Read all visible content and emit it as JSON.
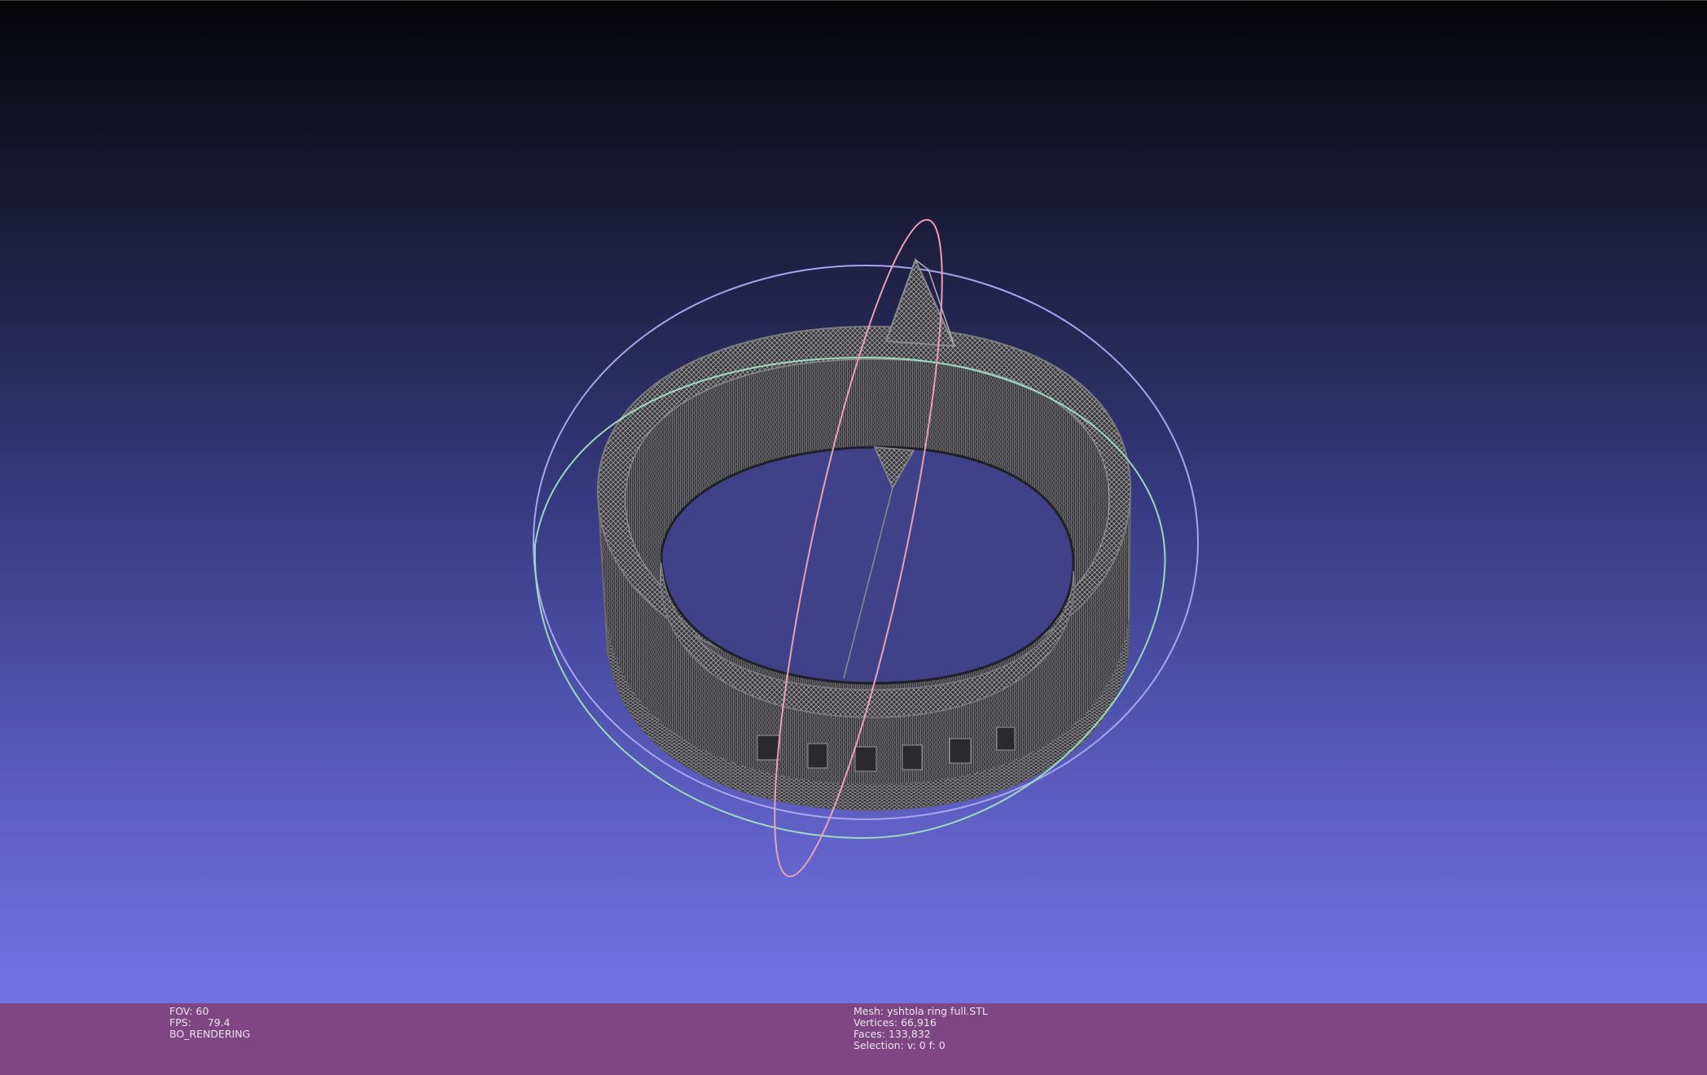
{
  "info_left": {
    "fov_label": "FOV:",
    "fov_value": "60",
    "fps_label": "FPS:",
    "fps_value": "79.4",
    "render_mode": "BO_RENDERING"
  },
  "info_center": {
    "mesh_label": "Mesh:",
    "mesh_value": "yshtola ring full.STL",
    "vertices_label": "Vertices:",
    "vertices_value": "66,916",
    "faces_label": "Faces:",
    "faces_value": "133,832",
    "selection_label": "Selection:",
    "selection_value": "v: 0 f: 0"
  },
  "colors": {
    "info_bar": "#7e4683",
    "mesh_wire": "#9a9a9a",
    "trackball_x": "#e8a0b4",
    "trackball_y": "#a9a4f0",
    "trackball_z": "#a0e0c0"
  }
}
